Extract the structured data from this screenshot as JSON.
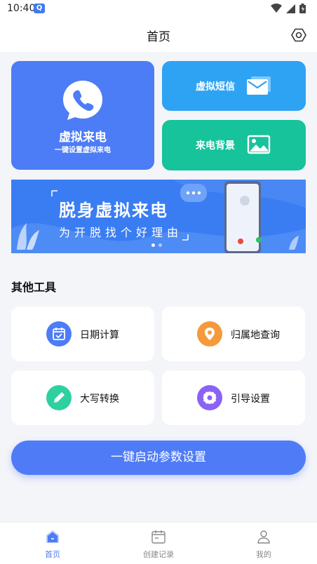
{
  "status_bar": {
    "time": "10:40",
    "app_icon_glyph": "Q"
  },
  "header": {
    "title": "首页",
    "settings_icon": "settings-icon"
  },
  "cards": {
    "virtual_call": {
      "title": "虚拟来电",
      "subtitle": "一键设置虚拟来电",
      "color": "#4d7cf7"
    },
    "virtual_sms": {
      "label": "虚拟短信",
      "color": "#2ea3f4"
    },
    "call_background": {
      "label": "来电背景",
      "color": "#17c39b"
    }
  },
  "banner": {
    "title": "脱身虚拟来电",
    "subtitle": "为开脱找个好理由",
    "color": "#3a7df3"
  },
  "tools_section": {
    "title": "其他工具",
    "items": [
      {
        "label": "日期计算",
        "icon": "calendar-check-icon",
        "color": "#4d7cf7"
      },
      {
        "label": "归属地查询",
        "icon": "location-pin-icon",
        "color": "#f59a3c"
      },
      {
        "label": "大写转换",
        "icon": "pencil-icon",
        "color": "#2fd0a0"
      },
      {
        "label": "引导设置",
        "icon": "gear-icon",
        "color": "#8a63f5"
      }
    ]
  },
  "primary_action": {
    "label": "一键启动参数设置",
    "color": "#4f7cf6"
  },
  "bottom_nav": {
    "items": [
      {
        "label": "首页",
        "icon": "home-icon",
        "active": true
      },
      {
        "label": "创建记录",
        "icon": "records-icon",
        "active": false
      },
      {
        "label": "我的",
        "icon": "profile-icon",
        "active": false
      }
    ]
  }
}
